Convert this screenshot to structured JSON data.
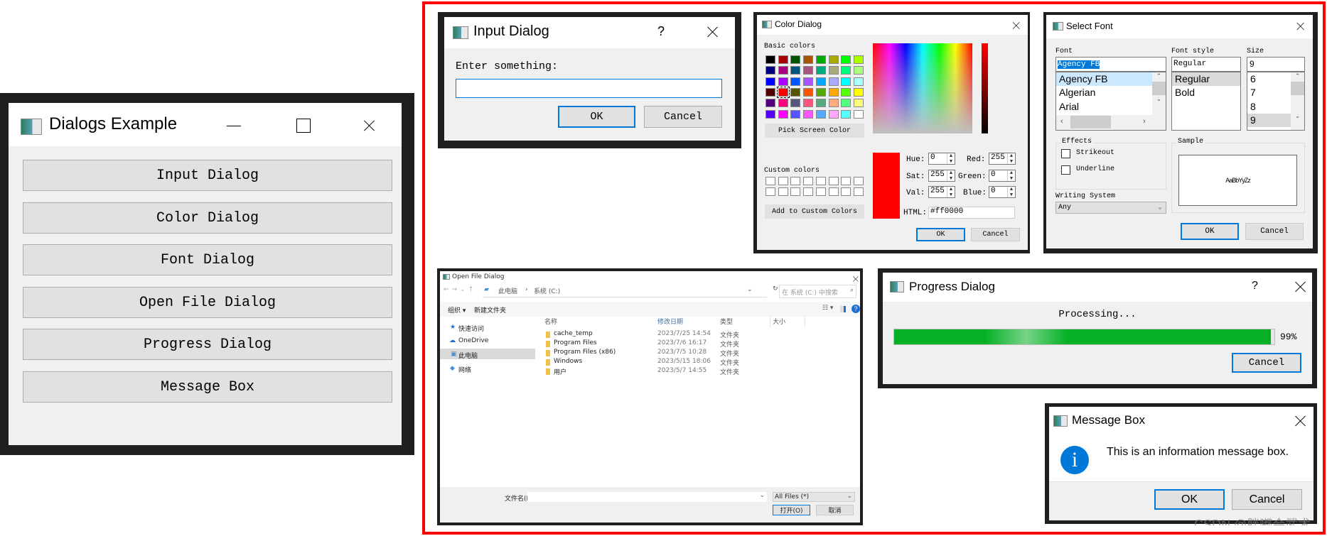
{
  "main_window": {
    "title": "Dialogs Example",
    "buttons": [
      "Input Dialog",
      "Color Dialog",
      "Font Dialog",
      "Open File Dialog",
      "Progress Dialog",
      "Message Box"
    ]
  },
  "input_dialog": {
    "title": "Input Dialog",
    "help": "?",
    "prompt": "Enter something:",
    "value": "",
    "ok": "OK",
    "cancel": "Cancel"
  },
  "color_dialog": {
    "title": "Color Dialog",
    "basic_label": "Basic colors",
    "basic_colors": [
      "#000000",
      "#aa0000",
      "#005500",
      "#aa5500",
      "#00aa00",
      "#aaaa00",
      "#00ff00",
      "#aaff00",
      "#00007f",
      "#aa007f",
      "#00557f",
      "#aa557f",
      "#00aa7f",
      "#aaaa7f",
      "#00ff7f",
      "#aaff7f",
      "#0000ff",
      "#aa00ff",
      "#0055ff",
      "#aa55ff",
      "#00aaff",
      "#aaaaff",
      "#00ffff",
      "#aaffff",
      "#550000",
      "#ff0000",
      "#555500",
      "#ff5500",
      "#55aa00",
      "#ffaa00",
      "#55ff00",
      "#ffff00",
      "#55007f",
      "#ff007f",
      "#55557f",
      "#ff557f",
      "#55aa7f",
      "#ffaa7f",
      "#55ff7f",
      "#ffff7f",
      "#5500ff",
      "#ff00ff",
      "#5555ff",
      "#ff55ff",
      "#55aaff",
      "#ffaaff",
      "#55ffff",
      "#ffffff"
    ],
    "pick_screen": "Pick Screen Color",
    "custom_label": "Custom colors",
    "add_custom": "Add to Custom Colors",
    "current_color": "#ff0000",
    "hue_label": "Hue:",
    "hue": "0",
    "sat_label": "Sat:",
    "sat": "255",
    "val_label": "Val:",
    "val": "255",
    "red_label": "Red:",
    "red": "255",
    "green_label": "Green:",
    "green": "0",
    "blue_label": "Blue:",
    "blue": "0",
    "html_label": "HTML:",
    "html": "#ff0000",
    "ok": "OK",
    "cancel": "Cancel"
  },
  "font_dialog": {
    "title": "Select Font",
    "font_label": "Font",
    "font_value": "Agency FB",
    "fonts": [
      "Agency FB",
      "Algerian",
      "Arial"
    ],
    "style_label": "Font style",
    "style_value": "Regular",
    "styles": [
      "Regular",
      "Bold"
    ],
    "size_label": "Size",
    "size_value": "9",
    "sizes": [
      "6",
      "7",
      "8",
      "9"
    ],
    "effects_label": "Effects",
    "strikeout": "Strikeout",
    "underline": "Underline",
    "writing_label": "Writing System",
    "writing_value": "Any",
    "sample_label": "Sample",
    "sample_text": "AaBbYyZz",
    "ok": "OK",
    "cancel": "Cancel"
  },
  "file_dialog": {
    "title": "Open File Dialog",
    "path": [
      "此电脑",
      "系统 (C:)"
    ],
    "search_placeholder": "在 系统 (C:) 中搜索",
    "organize": "组织 ▾",
    "new_folder": "新建文件夹",
    "sidebar": [
      "快速访问",
      "OneDrive",
      "此电脑",
      "网络"
    ],
    "columns": [
      "名称",
      "修改日期",
      "类型",
      "大小"
    ],
    "rows": [
      {
        "name": "cache_temp",
        "date": "2023/7/25 14:54",
        "type": "文件夹"
      },
      {
        "name": "Program Files",
        "date": "2023/7/6 16:17",
        "type": "文件夹"
      },
      {
        "name": "Program Files (x86)",
        "date": "2023/7/5 10:28",
        "type": "文件夹"
      },
      {
        "name": "Windows",
        "date": "2023/5/15 18:06",
        "type": "文件夹"
      },
      {
        "name": "用户",
        "date": "2023/5/7 14:55",
        "type": "文件夹"
      }
    ],
    "filename_label": "文件名(N):",
    "filename": "",
    "filter": "All Files (*)",
    "open": "打开(O)",
    "cancel": "取消"
  },
  "progress_dialog": {
    "title": "Progress Dialog",
    "help": "?",
    "label": "Processing...",
    "value": 99,
    "value_text": "99%",
    "cancel": "Cancel",
    "bar_color": "#06b025"
  },
  "message_box": {
    "title": "Message Box",
    "text": "This is an information message box.",
    "ok": "OK",
    "cancel": "Cancel",
    "icon_color": "#0078d7"
  },
  "watermark": "CSDN @胖嘟会武术",
  "highlight_color": "#ff0000"
}
